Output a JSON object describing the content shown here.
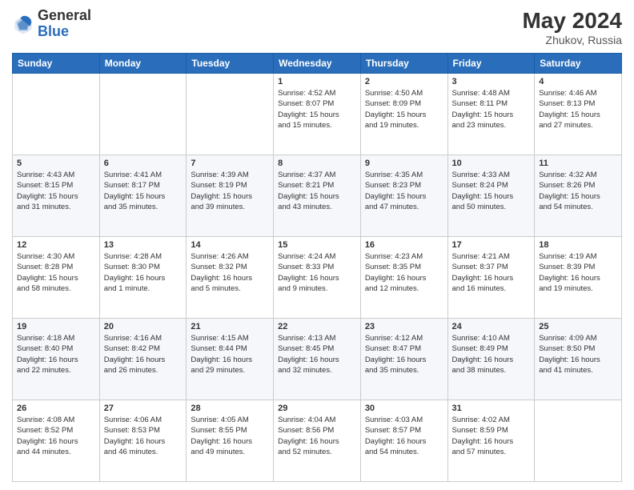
{
  "header": {
    "logo_general": "General",
    "logo_blue": "Blue",
    "month_year": "May 2024",
    "location": "Zhukov, Russia"
  },
  "days_of_week": [
    "Sunday",
    "Monday",
    "Tuesday",
    "Wednesday",
    "Thursday",
    "Friday",
    "Saturday"
  ],
  "weeks": [
    [
      {
        "day": "",
        "info": ""
      },
      {
        "day": "",
        "info": ""
      },
      {
        "day": "",
        "info": ""
      },
      {
        "day": "1",
        "info": "Sunrise: 4:52 AM\nSunset: 8:07 PM\nDaylight: 15 hours\nand 15 minutes."
      },
      {
        "day": "2",
        "info": "Sunrise: 4:50 AM\nSunset: 8:09 PM\nDaylight: 15 hours\nand 19 minutes."
      },
      {
        "day": "3",
        "info": "Sunrise: 4:48 AM\nSunset: 8:11 PM\nDaylight: 15 hours\nand 23 minutes."
      },
      {
        "day": "4",
        "info": "Sunrise: 4:46 AM\nSunset: 8:13 PM\nDaylight: 15 hours\nand 27 minutes."
      }
    ],
    [
      {
        "day": "5",
        "info": "Sunrise: 4:43 AM\nSunset: 8:15 PM\nDaylight: 15 hours\nand 31 minutes."
      },
      {
        "day": "6",
        "info": "Sunrise: 4:41 AM\nSunset: 8:17 PM\nDaylight: 15 hours\nand 35 minutes."
      },
      {
        "day": "7",
        "info": "Sunrise: 4:39 AM\nSunset: 8:19 PM\nDaylight: 15 hours\nand 39 minutes."
      },
      {
        "day": "8",
        "info": "Sunrise: 4:37 AM\nSunset: 8:21 PM\nDaylight: 15 hours\nand 43 minutes."
      },
      {
        "day": "9",
        "info": "Sunrise: 4:35 AM\nSunset: 8:23 PM\nDaylight: 15 hours\nand 47 minutes."
      },
      {
        "day": "10",
        "info": "Sunrise: 4:33 AM\nSunset: 8:24 PM\nDaylight: 15 hours\nand 50 minutes."
      },
      {
        "day": "11",
        "info": "Sunrise: 4:32 AM\nSunset: 8:26 PM\nDaylight: 15 hours\nand 54 minutes."
      }
    ],
    [
      {
        "day": "12",
        "info": "Sunrise: 4:30 AM\nSunset: 8:28 PM\nDaylight: 15 hours\nand 58 minutes."
      },
      {
        "day": "13",
        "info": "Sunrise: 4:28 AM\nSunset: 8:30 PM\nDaylight: 16 hours\nand 1 minute."
      },
      {
        "day": "14",
        "info": "Sunrise: 4:26 AM\nSunset: 8:32 PM\nDaylight: 16 hours\nand 5 minutes."
      },
      {
        "day": "15",
        "info": "Sunrise: 4:24 AM\nSunset: 8:33 PM\nDaylight: 16 hours\nand 9 minutes."
      },
      {
        "day": "16",
        "info": "Sunrise: 4:23 AM\nSunset: 8:35 PM\nDaylight: 16 hours\nand 12 minutes."
      },
      {
        "day": "17",
        "info": "Sunrise: 4:21 AM\nSunset: 8:37 PM\nDaylight: 16 hours\nand 16 minutes."
      },
      {
        "day": "18",
        "info": "Sunrise: 4:19 AM\nSunset: 8:39 PM\nDaylight: 16 hours\nand 19 minutes."
      }
    ],
    [
      {
        "day": "19",
        "info": "Sunrise: 4:18 AM\nSunset: 8:40 PM\nDaylight: 16 hours\nand 22 minutes."
      },
      {
        "day": "20",
        "info": "Sunrise: 4:16 AM\nSunset: 8:42 PM\nDaylight: 16 hours\nand 26 minutes."
      },
      {
        "day": "21",
        "info": "Sunrise: 4:15 AM\nSunset: 8:44 PM\nDaylight: 16 hours\nand 29 minutes."
      },
      {
        "day": "22",
        "info": "Sunrise: 4:13 AM\nSunset: 8:45 PM\nDaylight: 16 hours\nand 32 minutes."
      },
      {
        "day": "23",
        "info": "Sunrise: 4:12 AM\nSunset: 8:47 PM\nDaylight: 16 hours\nand 35 minutes."
      },
      {
        "day": "24",
        "info": "Sunrise: 4:10 AM\nSunset: 8:49 PM\nDaylight: 16 hours\nand 38 minutes."
      },
      {
        "day": "25",
        "info": "Sunrise: 4:09 AM\nSunset: 8:50 PM\nDaylight: 16 hours\nand 41 minutes."
      }
    ],
    [
      {
        "day": "26",
        "info": "Sunrise: 4:08 AM\nSunset: 8:52 PM\nDaylight: 16 hours\nand 44 minutes."
      },
      {
        "day": "27",
        "info": "Sunrise: 4:06 AM\nSunset: 8:53 PM\nDaylight: 16 hours\nand 46 minutes."
      },
      {
        "day": "28",
        "info": "Sunrise: 4:05 AM\nSunset: 8:55 PM\nDaylight: 16 hours\nand 49 minutes."
      },
      {
        "day": "29",
        "info": "Sunrise: 4:04 AM\nSunset: 8:56 PM\nDaylight: 16 hours\nand 52 minutes."
      },
      {
        "day": "30",
        "info": "Sunrise: 4:03 AM\nSunset: 8:57 PM\nDaylight: 16 hours\nand 54 minutes."
      },
      {
        "day": "31",
        "info": "Sunrise: 4:02 AM\nSunset: 8:59 PM\nDaylight: 16 hours\nand 57 minutes."
      },
      {
        "day": "",
        "info": ""
      }
    ]
  ]
}
